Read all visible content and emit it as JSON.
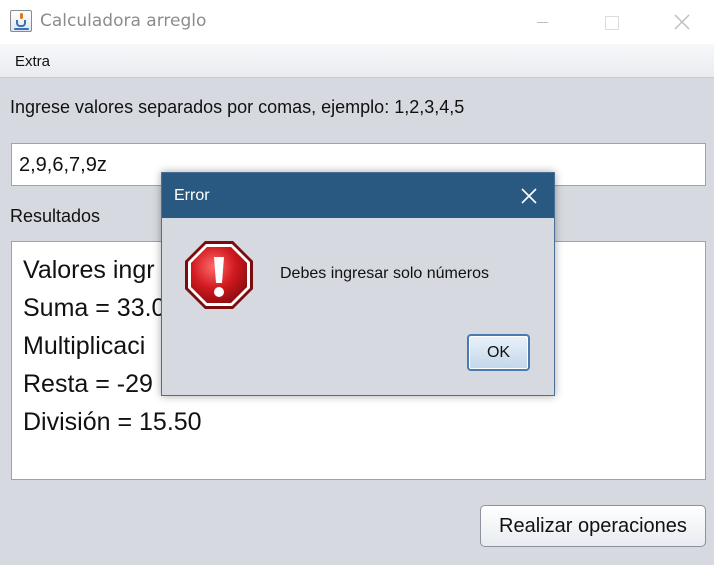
{
  "window": {
    "title": "Calculadora arreglo"
  },
  "menu": {
    "extra_label": "Extra"
  },
  "main": {
    "instruction": "Ingrese valores separados por comas, ejemplo: 1,2,3,4,5",
    "input_value": "2,9,6,7,9z",
    "results_label": "Resultados",
    "results_lines": [
      "Valores ingr",
      "Suma = 33.0",
      "Multiplicaci",
      "Resta = -29",
      "División = 15.50"
    ],
    "action_button": "Realizar operaciones"
  },
  "dialog": {
    "title": "Error",
    "message": "Debes ingresar solo números",
    "ok_label": "OK",
    "icon": "error-icon"
  },
  "colors": {
    "dialog_titlebar": "#295881",
    "window_background": "#d6d9df",
    "error_red": "#c8141b"
  }
}
